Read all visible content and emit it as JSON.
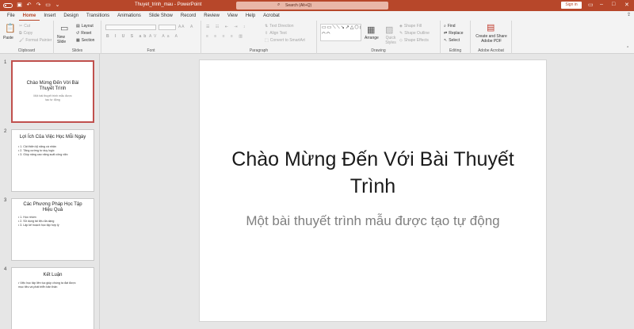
{
  "titlebar": {
    "title": "Thuyet_trinh_mau  -  PowerPoint",
    "search_placeholder": "Search (Alt+Q)",
    "signin": "Sign in"
  },
  "tabs": [
    "File",
    "Home",
    "Insert",
    "Design",
    "Transitions",
    "Animations",
    "Slide Show",
    "Record",
    "Review",
    "View",
    "Help",
    "Acrobat"
  ],
  "active_tab": "Home",
  "ribbon": {
    "clipboard": {
      "paste": "Paste",
      "cut": "Cut",
      "copy": "Copy",
      "format_painter": "Format Painter",
      "label": "Clipboard"
    },
    "slides": {
      "new_slide": "New Slide",
      "layout": "Layout",
      "reset": "Reset",
      "section": "Section",
      "label": "Slides"
    },
    "font": {
      "label": "Font"
    },
    "paragraph": {
      "text_direction": "Text Direction",
      "align_text": "Align Text",
      "convert_smartart": "Convert to SmartArt",
      "label": "Paragraph"
    },
    "drawing": {
      "arrange": "Arrange",
      "quick_styles": "Quick Styles",
      "shape_fill": "Shape Fill",
      "shape_outline": "Shape Outline",
      "shape_effects": "Shape Effects",
      "label": "Drawing"
    },
    "editing": {
      "find": "Find",
      "replace": "Replace",
      "select": "Select",
      "label": "Editing"
    },
    "acrobat": {
      "create_share": "Create and Share Adobe PDF",
      "label": "Adobe Acrobat"
    }
  },
  "thumbnails": [
    {
      "num": "1",
      "title": "Chào Mừng Đến Với Bài Thuyết Trình",
      "subtitle": "Một bài thuyết trình mẫu được tạo tự động",
      "items": []
    },
    {
      "num": "2",
      "title": "Lợi Ích Của Việc Học Mỗi Ngày",
      "subtitle": "",
      "items": [
        "1. Cải thiện kỹ năng cá nhân",
        "2. Tăng cường tư duy logic",
        "3. Giúp nâng cao năng suất công việc"
      ]
    },
    {
      "num": "3",
      "title": "Các Phương Pháp Học Tập Hiệu Quả",
      "subtitle": "",
      "items": [
        "1. Học nhóm",
        "2. Sử dụng tài liệu đa dạng",
        "3. Lập kế hoạch học tập hợp lý"
      ]
    },
    {
      "num": "4",
      "title": "Kết Luận",
      "subtitle": "",
      "items": [
        "Việc học tập liên tục giúp chúng ta đạt được mục tiêu và phát triển bản thân"
      ]
    }
  ],
  "slide": {
    "title": "Chào Mừng Đến Với Bài Thuyết Trình",
    "subtitle": "Một bài thuyết trình mẫu được tạo tự động"
  }
}
